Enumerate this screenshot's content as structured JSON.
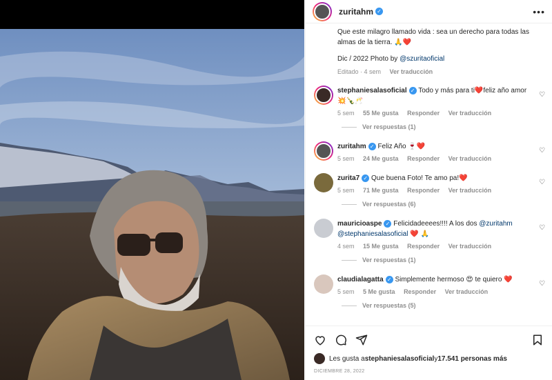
{
  "post": {
    "username": "zuritahm",
    "caption_line1": "Que este milagro llamado vida : sea un derecho para todas las",
    "caption_line2": "almas de la tierra. 🙏❤️",
    "credit_prefix": "Dic / 2022 Photo by ",
    "credit_mention": "@szuritaoficial",
    "edited": "Editado · 4 sem",
    "translate": "Ver traducción"
  },
  "comments": [
    {
      "username": "stephaniesalasoficial",
      "text": "Todo y más para ti❤️feliz año amor💥🍾🥂",
      "time": "5 sem",
      "likes": "55 Me gusta",
      "reply": "Responder",
      "translate": "Ver traducción",
      "replies": "Ver respuestas (1)"
    },
    {
      "username": "zuritahm",
      "text": "Feliz Año 🍷❤️",
      "time": "5 sem",
      "likes": "24 Me gusta",
      "reply": "Responder",
      "translate": "Ver traducción",
      "replies": ""
    },
    {
      "username": "zurita7",
      "text": "Que buena Foto! Te amo pa!❤️",
      "time": "5 sem",
      "likes": "71 Me gusta",
      "reply": "Responder",
      "translate": "Ver traducción",
      "replies": "Ver respuestas (6)"
    },
    {
      "username": "mauricioaspe",
      "text": "Felicidadeeees!!!! A los dos ",
      "mention1": "@zuritahm",
      "mention2": "@stephaniesalasoficial",
      "text_end": " ❤️ 🙏",
      "time": "4 sem",
      "likes": "15 Me gusta",
      "reply": "Responder",
      "translate": "Ver traducción",
      "replies": "Ver respuestas (1)"
    },
    {
      "username": "claudialagatta",
      "text": "Simplemente hermoso 😍 te quiero ❤️",
      "time": "5 sem",
      "likes": "5 Me gusta",
      "reply": "Responder",
      "translate": "Ver traducción",
      "replies": "Ver respuestas (5)"
    }
  ],
  "likes_line": {
    "prefix": "Les gusta a ",
    "user": "stephaniesalasoficial",
    "middle": " y ",
    "count": "17.541 personas más"
  },
  "date": "DICIEMBRE 28, 2022",
  "icons": {
    "more": "more-options-icon",
    "like": "heart-icon",
    "comment": "comment-icon",
    "share": "share-icon",
    "save": "bookmark-icon",
    "comment_like": "small-heart-icon"
  },
  "colors": {
    "verified": "#3897f0",
    "link": "#00376b",
    "muted": "#8e8e8e"
  }
}
